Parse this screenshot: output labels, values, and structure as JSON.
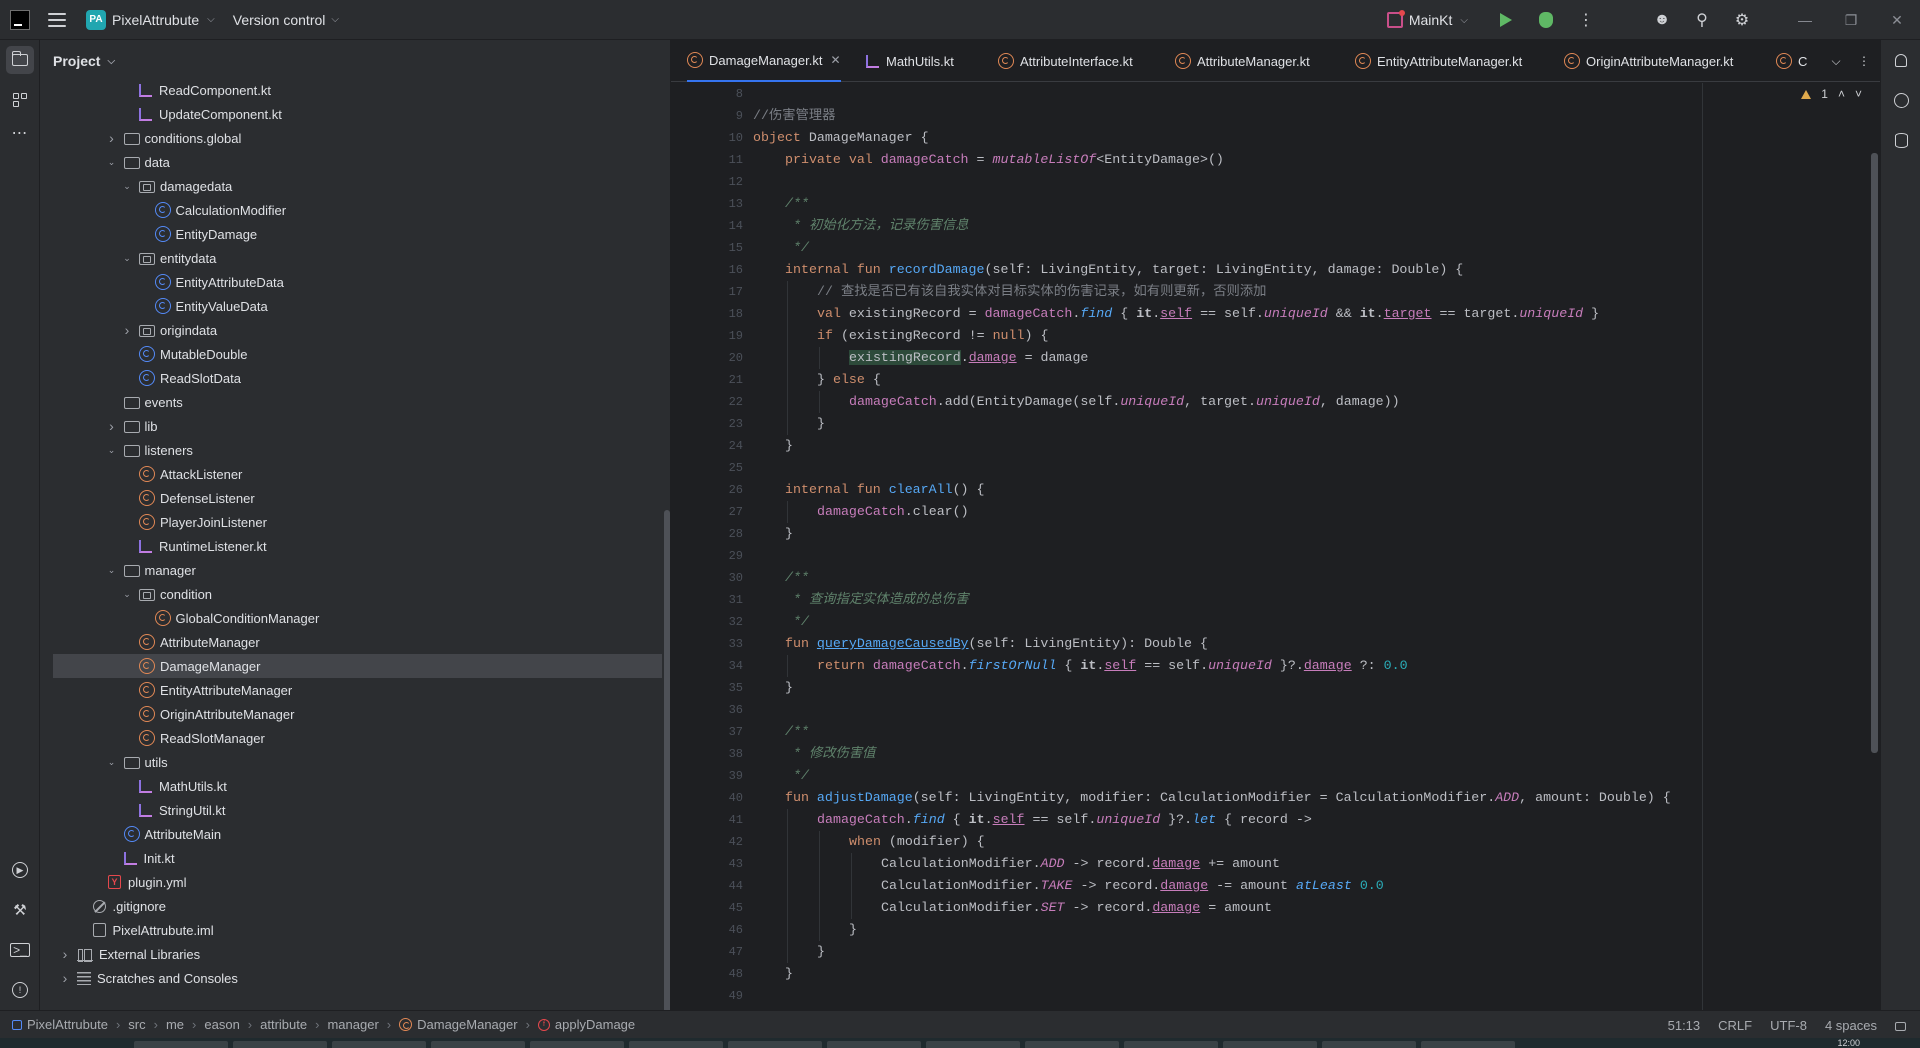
{
  "titlebar": {
    "project_badge": "PA",
    "project_name": "PixelAttrubute",
    "vcs_label": "Version control",
    "run_config": "MainKt"
  },
  "project_panel": {
    "title": "Project",
    "tree": [
      {
        "depth": 4,
        "chevron": "",
        "icon": "kt",
        "label": "ReadComponent.kt"
      },
      {
        "depth": 4,
        "chevron": "",
        "icon": "kt",
        "label": "UpdateComponent.kt"
      },
      {
        "depth": 3,
        "chevron": "right",
        "icon": "plain-folder",
        "label": "conditions.global"
      },
      {
        "depth": 3,
        "chevron": "down",
        "icon": "plain-folder",
        "label": "data"
      },
      {
        "depth": 4,
        "chevron": "down",
        "icon": "folder",
        "label": "damagedata"
      },
      {
        "depth": 5,
        "chevron": "",
        "icon": "class",
        "label": "CalculationModifier"
      },
      {
        "depth": 5,
        "chevron": "",
        "icon": "class",
        "label": "EntityDamage"
      },
      {
        "depth": 4,
        "chevron": "down",
        "icon": "folder",
        "label": "entitydata"
      },
      {
        "depth": 5,
        "chevron": "",
        "icon": "class",
        "label": "EntityAttributeData"
      },
      {
        "depth": 5,
        "chevron": "",
        "icon": "class",
        "label": "EntityValueData"
      },
      {
        "depth": 4,
        "chevron": "right",
        "icon": "folder",
        "label": "origindata"
      },
      {
        "depth": 4,
        "chevron": "",
        "icon": "class",
        "label": "MutableDouble"
      },
      {
        "depth": 4,
        "chevron": "",
        "icon": "class",
        "label": "ReadSlotData"
      },
      {
        "depth": 3,
        "chevron": "",
        "icon": "plain-folder",
        "label": "events"
      },
      {
        "depth": 3,
        "chevron": "right",
        "icon": "plain-folder",
        "label": "lib"
      },
      {
        "depth": 3,
        "chevron": "down",
        "icon": "plain-folder",
        "label": "listeners"
      },
      {
        "depth": 4,
        "chevron": "",
        "icon": "object",
        "label": "AttackListener"
      },
      {
        "depth": 4,
        "chevron": "",
        "icon": "object",
        "label": "DefenseListener"
      },
      {
        "depth": 4,
        "chevron": "",
        "icon": "object",
        "label": "PlayerJoinListener"
      },
      {
        "depth": 4,
        "chevron": "",
        "icon": "kt",
        "label": "RuntimeListener.kt"
      },
      {
        "depth": 3,
        "chevron": "down",
        "icon": "plain-folder",
        "label": "manager"
      },
      {
        "depth": 4,
        "chevron": "down",
        "icon": "folder",
        "label": "condition"
      },
      {
        "depth": 5,
        "chevron": "",
        "icon": "object",
        "label": "GlobalConditionManager"
      },
      {
        "depth": 4,
        "chevron": "",
        "icon": "object",
        "label": "AttributeManager"
      },
      {
        "depth": 4,
        "chevron": "",
        "icon": "object",
        "label": "DamageManager",
        "selected": true
      },
      {
        "depth": 4,
        "chevron": "",
        "icon": "object",
        "label": "EntityAttributeManager"
      },
      {
        "depth": 4,
        "chevron": "",
        "icon": "object",
        "label": "OriginAttributeManager"
      },
      {
        "depth": 4,
        "chevron": "",
        "icon": "object",
        "label": "ReadSlotManager"
      },
      {
        "depth": 3,
        "chevron": "down",
        "icon": "plain-folder",
        "label": "utils"
      },
      {
        "depth": 4,
        "chevron": "",
        "icon": "kt",
        "label": "MathUtils.kt"
      },
      {
        "depth": 4,
        "chevron": "",
        "icon": "kt",
        "label": "StringUtil.kt"
      },
      {
        "depth": 3,
        "chevron": "",
        "icon": "class",
        "label": "AttributeMain"
      },
      {
        "depth": 3,
        "chevron": "",
        "icon": "kt",
        "label": "Init.kt"
      },
      {
        "depth": 2,
        "chevron": "",
        "icon": "yml",
        "label": "plugin.yml"
      },
      {
        "depth": 1,
        "chevron": "",
        "icon": "ignore",
        "label": ".gitignore"
      },
      {
        "depth": 1,
        "chevron": "",
        "icon": "iml",
        "label": "PixelAttrubute.iml"
      },
      {
        "depth": 0,
        "chevron": "right",
        "icon": "lib",
        "label": "External Libraries"
      },
      {
        "depth": 0,
        "chevron": "right",
        "icon": "scratch",
        "label": "Scratches and Consoles"
      }
    ]
  },
  "tabs": [
    {
      "label": "DamageManager.kt",
      "icon": "object",
      "active": true,
      "closable": true
    },
    {
      "label": "MathUtils.kt",
      "icon": "kt"
    },
    {
      "label": "AttributeInterface.kt",
      "icon": "object"
    },
    {
      "label": "AttributeManager.kt",
      "icon": "object"
    },
    {
      "label": "EntityAttributeManager.kt",
      "icon": "object"
    },
    {
      "label": "OriginAttributeManager.kt",
      "icon": "object"
    },
    {
      "label": "C",
      "icon": "object"
    }
  ],
  "editor": {
    "inspection_count": "1",
    "lines": [
      {
        "n": "8",
        "indent": 0,
        "t": []
      },
      {
        "n": "9",
        "indent": 0,
        "t": [
          [
            "cm",
            "//伤害管理器"
          ]
        ]
      },
      {
        "n": "10",
        "indent": 0,
        "t": [
          [
            "k",
            "object "
          ],
          [
            "",
            "DamageManager {"
          ]
        ]
      },
      {
        "n": "11",
        "indent": 1,
        "t": [
          [
            "k",
            "private val "
          ],
          [
            "pp",
            "damageCatch"
          ],
          [
            "",
            " = "
          ],
          [
            "it2",
            "mutableListOf"
          ],
          [
            "",
            "<EntityDamage>()"
          ]
        ]
      },
      {
        "n": "12",
        "indent": 0,
        "t": []
      },
      {
        "n": "13",
        "indent": 1,
        "t": [
          [
            "dc",
            "/**"
          ]
        ]
      },
      {
        "n": "14",
        "indent": 1,
        "t": [
          [
            "dc",
            " * 初始化方法，记录伤害信息"
          ]
        ]
      },
      {
        "n": "15",
        "indent": 1,
        "t": [
          [
            "dc",
            " */"
          ]
        ]
      },
      {
        "n": "16",
        "indent": 1,
        "t": [
          [
            "k",
            "internal fun "
          ],
          [
            "fn",
            "recordDamage"
          ],
          [
            "",
            "(self: LivingEntity, target: LivingEntity, damage: Double) {"
          ]
        ]
      },
      {
        "n": "17",
        "indent": 2,
        "t": [
          [
            "cm",
            "// 查找是否已有该自我实体对目标实体的伤害记录，如有则更新，否则添加"
          ]
        ]
      },
      {
        "n": "18",
        "indent": 2,
        "t": [
          [
            "k",
            "val "
          ],
          [
            "",
            "existingRecord = "
          ],
          [
            "pp",
            "damageCatch"
          ],
          [
            "",
            "."
          ],
          [
            "itf",
            "find"
          ],
          [
            "",
            " { "
          ],
          [
            "b",
            "it"
          ],
          [
            "",
            "."
          ],
          [
            "ppu",
            "self"
          ],
          [
            "",
            " == self."
          ],
          [
            "it",
            "uniqueId"
          ],
          [
            "",
            " && "
          ],
          [
            "b",
            "it"
          ],
          [
            "",
            "."
          ],
          [
            "ppu",
            "target"
          ],
          [
            "",
            " == target."
          ],
          [
            "it",
            "uniqueId"
          ],
          [
            "",
            " }"
          ]
        ]
      },
      {
        "n": "19",
        "indent": 2,
        "t": [
          [
            "k",
            "if "
          ],
          [
            "",
            "(existingRecord != "
          ],
          [
            "k",
            "null"
          ],
          [
            "",
            ") {"
          ]
        ]
      },
      {
        "n": "20",
        "indent": 3,
        "t": [
          [
            "hl",
            "existingRecord"
          ],
          [
            "",
            "."
          ],
          [
            "ppu",
            "damage"
          ],
          [
            "",
            " = damage"
          ]
        ]
      },
      {
        "n": "21",
        "indent": 2,
        "t": [
          [
            "",
            "} "
          ],
          [
            "k",
            "else "
          ],
          [
            "",
            "{"
          ]
        ]
      },
      {
        "n": "22",
        "indent": 3,
        "t": [
          [
            "pp",
            "damageCatch"
          ],
          [
            "",
            ".add(EntityDamage(self."
          ],
          [
            "it",
            "uniqueId"
          ],
          [
            "",
            ", target."
          ],
          [
            "it",
            "uniqueId"
          ],
          [
            "",
            ", damage))"
          ]
        ]
      },
      {
        "n": "23",
        "indent": 2,
        "t": [
          [
            "",
            "}"
          ]
        ]
      },
      {
        "n": "24",
        "indent": 1,
        "t": [
          [
            "",
            "}"
          ]
        ]
      },
      {
        "n": "25",
        "indent": 0,
        "t": []
      },
      {
        "n": "26",
        "indent": 1,
        "t": [
          [
            "k",
            "internal fun "
          ],
          [
            "fn",
            "clearAll"
          ],
          [
            "",
            "() {"
          ]
        ]
      },
      {
        "n": "27",
        "indent": 2,
        "t": [
          [
            "pp",
            "damageCatch"
          ],
          [
            "",
            ".clear()"
          ]
        ]
      },
      {
        "n": "28",
        "indent": 1,
        "t": [
          [
            "",
            "}"
          ]
        ]
      },
      {
        "n": "29",
        "indent": 0,
        "t": []
      },
      {
        "n": "30",
        "indent": 1,
        "t": [
          [
            "dc",
            "/**"
          ]
        ]
      },
      {
        "n": "31",
        "indent": 1,
        "t": [
          [
            "dc",
            " * 查询指定实体造成的总伤害"
          ]
        ]
      },
      {
        "n": "32",
        "indent": 1,
        "t": [
          [
            "dc",
            " */"
          ]
        ]
      },
      {
        "n": "33",
        "indent": 1,
        "t": [
          [
            "k",
            "fun "
          ],
          [
            "fnu",
            "queryDamageCausedBy"
          ],
          [
            "",
            "(self: LivingEntity): Double {"
          ]
        ]
      },
      {
        "n": "34",
        "indent": 2,
        "t": [
          [
            "k",
            "return "
          ],
          [
            "pp",
            "damageCatch"
          ],
          [
            "",
            "."
          ],
          [
            "itf",
            "firstOrNull"
          ],
          [
            "",
            " { "
          ],
          [
            "b",
            "it"
          ],
          [
            "",
            "."
          ],
          [
            "ppu",
            "self"
          ],
          [
            "",
            " == self."
          ],
          [
            "it",
            "uniqueId"
          ],
          [
            "",
            " }?."
          ],
          [
            "ppu",
            "damage"
          ],
          [
            "",
            " ?: "
          ],
          [
            "nm",
            "0.0"
          ]
        ]
      },
      {
        "n": "35",
        "indent": 1,
        "t": [
          [
            "",
            "}"
          ]
        ]
      },
      {
        "n": "36",
        "indent": 0,
        "t": []
      },
      {
        "n": "37",
        "indent": 1,
        "t": [
          [
            "dc",
            "/**"
          ]
        ]
      },
      {
        "n": "38",
        "indent": 1,
        "t": [
          [
            "dc",
            " * 修改伤害值"
          ]
        ]
      },
      {
        "n": "39",
        "indent": 1,
        "t": [
          [
            "dc",
            " */"
          ]
        ]
      },
      {
        "n": "40",
        "indent": 1,
        "t": [
          [
            "k",
            "fun "
          ],
          [
            "fn",
            "adjustDamage"
          ],
          [
            "",
            "(self: LivingEntity, modifier: CalculationModifier = CalculationModifier."
          ],
          [
            "it",
            "ADD"
          ],
          [
            "",
            ", amount: Double) {"
          ]
        ]
      },
      {
        "n": "41",
        "indent": 2,
        "t": [
          [
            "pp",
            "damageCatch"
          ],
          [
            "",
            "."
          ],
          [
            "itf",
            "find"
          ],
          [
            "",
            " { "
          ],
          [
            "b",
            "it"
          ],
          [
            "",
            "."
          ],
          [
            "ppu",
            "self"
          ],
          [
            "",
            " == self."
          ],
          [
            "it",
            "uniqueId"
          ],
          [
            "",
            " }?."
          ],
          [
            "itf",
            "let"
          ],
          [
            "",
            " { record ->"
          ]
        ]
      },
      {
        "n": "42",
        "indent": 3,
        "t": [
          [
            "k",
            "when "
          ],
          [
            "",
            "(modifier) {"
          ]
        ]
      },
      {
        "n": "43",
        "indent": 4,
        "t": [
          [
            "",
            "CalculationModifier."
          ],
          [
            "it",
            "ADD"
          ],
          [
            "",
            " -> record."
          ],
          [
            "ppu",
            "damage"
          ],
          [
            "",
            " += amount"
          ]
        ]
      },
      {
        "n": "44",
        "indent": 4,
        "t": [
          [
            "",
            "CalculationModifier."
          ],
          [
            "it",
            "TAKE"
          ],
          [
            "",
            " -> record."
          ],
          [
            "ppu",
            "damage"
          ],
          [
            "",
            " -= amount "
          ],
          [
            "itf",
            "atLeast"
          ],
          [
            "",
            " "
          ],
          [
            "nm",
            "0.0"
          ]
        ]
      },
      {
        "n": "45",
        "indent": 4,
        "t": [
          [
            "",
            "CalculationModifier."
          ],
          [
            "it",
            "SET"
          ],
          [
            "",
            " -> record."
          ],
          [
            "ppu",
            "damage"
          ],
          [
            "",
            " = amount"
          ]
        ]
      },
      {
        "n": "46",
        "indent": 3,
        "t": [
          [
            "",
            "}"
          ]
        ]
      },
      {
        "n": "47",
        "indent": 2,
        "t": [
          [
            "",
            "}"
          ]
        ]
      },
      {
        "n": "48",
        "indent": 1,
        "t": [
          [
            "",
            "}"
          ]
        ]
      },
      {
        "n": "49",
        "indent": 0,
        "t": []
      }
    ]
  },
  "statusbar": {
    "breadcrumbs": [
      "PixelAttrubute",
      "src",
      "me",
      "eason",
      "attribute",
      "manager",
      "DamageManager",
      "applyDamage"
    ],
    "position": "51:13",
    "line_separator": "CRLF",
    "encoding": "UTF-8",
    "indent": "4 spaces"
  },
  "taskbar": {
    "clock": "12:00"
  }
}
